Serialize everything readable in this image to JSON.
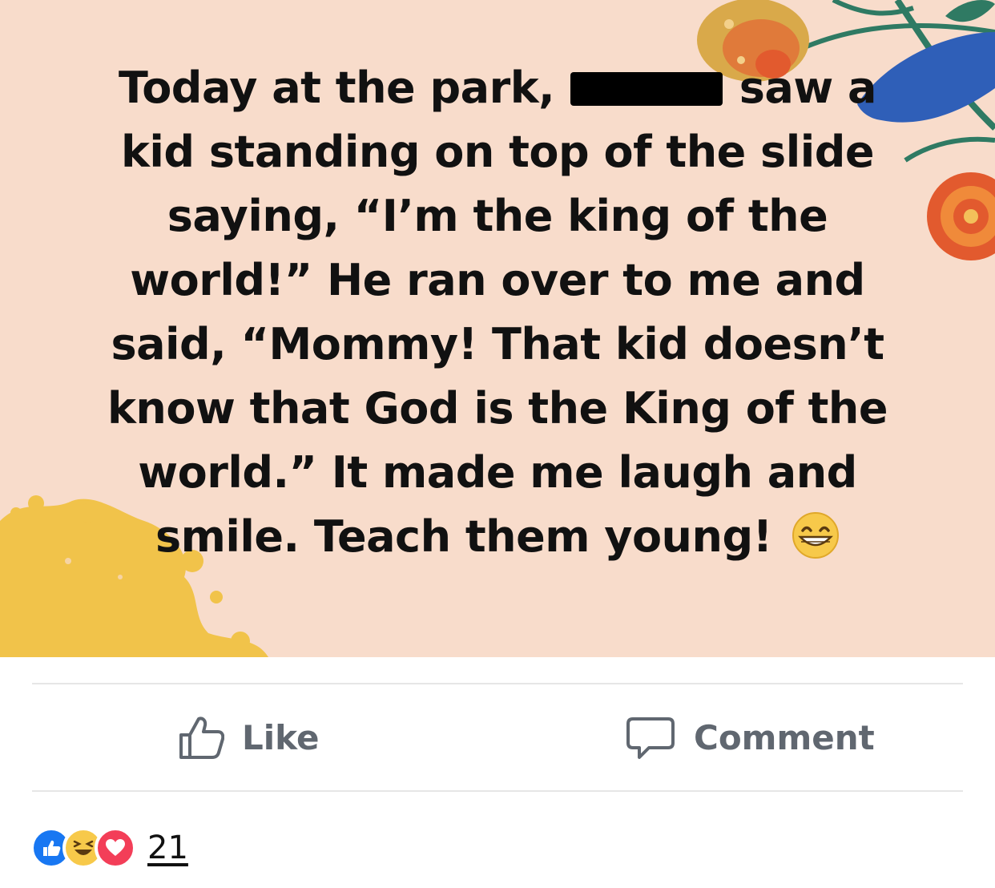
{
  "post": {
    "lines": [
      {
        "before": "Today at the park, ",
        "after": " saw a"
      },
      {
        "text": "kid standing on top of the slide"
      },
      {
        "text": "saying, “I’m the king of the"
      },
      {
        "text": "world!” He ran over to me and"
      },
      {
        "text": "said, “Mommy! That kid doesn’t"
      },
      {
        "text": "know that God is the King of the"
      },
      {
        "text": "world.” It made me laugh and"
      },
      {
        "text": "smile. Teach them young! "
      }
    ],
    "redacted_name": true,
    "emoji": "grinning-face-with-smiling-eyes",
    "background_color": "#f8dccb"
  },
  "actions": {
    "like_label": "Like",
    "comment_label": "Comment",
    "like_icon": "thumbs-up-icon",
    "comment_icon": "speech-bubble-icon"
  },
  "reactions": {
    "icons": [
      "like-reaction-icon",
      "haha-reaction-icon",
      "love-reaction-icon"
    ],
    "colors": {
      "like": "#1877f2",
      "haha": "#f7c94a",
      "love": "#f33e58"
    },
    "count": "21"
  }
}
